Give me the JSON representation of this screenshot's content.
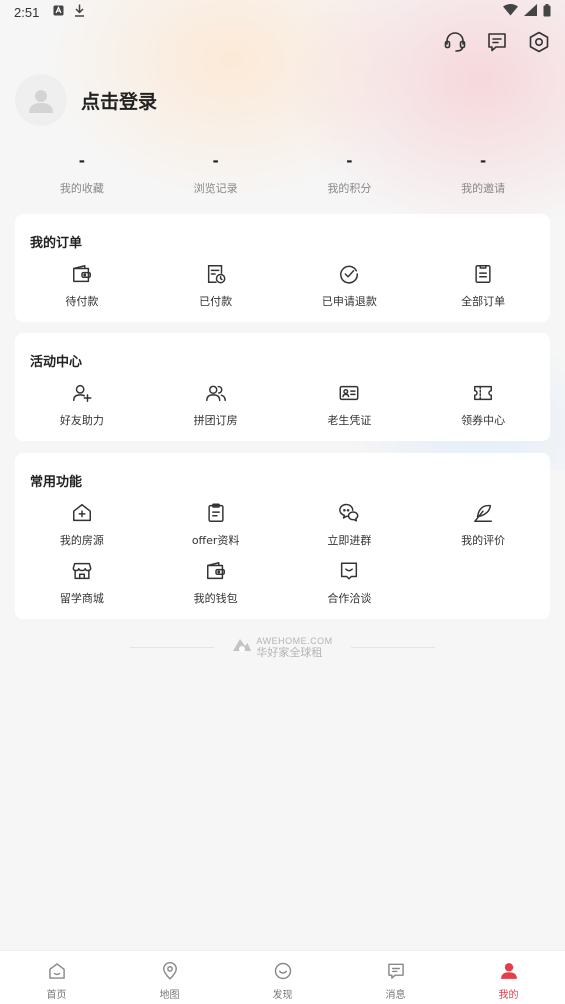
{
  "status_bar": {
    "time": "2:51"
  },
  "profile": {
    "login_label": "点击登录"
  },
  "stats": [
    {
      "value": "-",
      "label": "我的收藏"
    },
    {
      "value": "-",
      "label": "浏览记录"
    },
    {
      "value": "-",
      "label": "我的积分"
    },
    {
      "value": "-",
      "label": "我的邀请"
    }
  ],
  "orders": {
    "title": "我的订单",
    "items": [
      {
        "icon": "wallet-icon",
        "label": "待付款"
      },
      {
        "icon": "receipt-clock-icon",
        "label": "已付款"
      },
      {
        "icon": "check-circle-icon",
        "label": "已申请退款"
      },
      {
        "icon": "clipboard-icon",
        "label": "全部订单"
      }
    ]
  },
  "activity": {
    "title": "活动中心",
    "items": [
      {
        "icon": "add-friend-icon",
        "label": "好友助力"
      },
      {
        "icon": "group-icon",
        "label": "拼团订房"
      },
      {
        "icon": "id-card-icon",
        "label": "老生凭证"
      },
      {
        "icon": "ticket-icon",
        "label": "领券中心"
      }
    ]
  },
  "functions": {
    "title": "常用功能",
    "items": [
      {
        "icon": "house-plus-icon",
        "label": "我的房源"
      },
      {
        "icon": "clipboard-doc-icon",
        "label": "offer资料"
      },
      {
        "icon": "chat-group-icon",
        "label": "立即进群"
      },
      {
        "icon": "feather-pen-icon",
        "label": "我的评价"
      },
      {
        "icon": "store-icon",
        "label": "留学商城"
      },
      {
        "icon": "wallet-icon",
        "label": "我的钱包"
      },
      {
        "icon": "handshake-message-icon",
        "label": "合作洽谈"
      }
    ]
  },
  "footer": {
    "brand_en": "AWEHOME.COM",
    "brand_cn": "华好家全球租"
  },
  "tabbar": [
    {
      "icon": "home-icon",
      "label": "首页",
      "active": false
    },
    {
      "icon": "map-pin-icon",
      "label": "地图",
      "active": false
    },
    {
      "icon": "smile-icon",
      "label": "发现",
      "active": false
    },
    {
      "icon": "message-icon",
      "label": "消息",
      "active": false
    },
    {
      "icon": "user-icon",
      "label": "我的",
      "active": true
    }
  ],
  "colors": {
    "accent": "#e53d4a",
    "icon": "#333333",
    "muted": "#888888"
  }
}
